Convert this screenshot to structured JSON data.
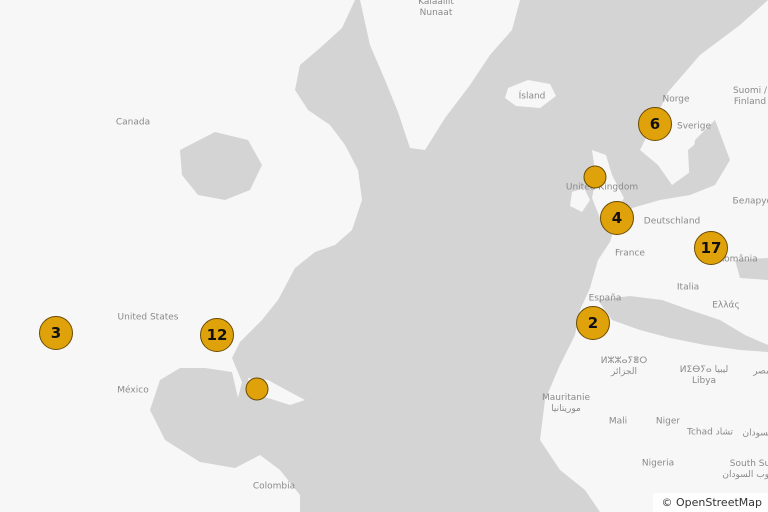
{
  "places": {
    "kalaallit": "Kalaallit",
    "nunaat": "Nunaat",
    "island": "Ísland",
    "canada": "Canada",
    "norge": "Norge",
    "suomi": "Suomi /",
    "finland": "Finland",
    "sverige": "Sverige",
    "uk": "United Kingdom",
    "deutschland": "Deutschland",
    "belarus": "Беларус",
    "france": "France",
    "romania": "România",
    "italia": "Italia",
    "espana": "España",
    "ellas": "Ελλάς",
    "united_states": "United States",
    "algeria_tif": "ⵍⵣⵣⴰⵢⴻⵔ",
    "algeria_ar": "الجزائر",
    "libya_tif": "ⵍⵉⴱⵢⴰ ليبيا",
    "libya": "Libya",
    "egypt_frag": "مصر",
    "mexico": "México",
    "mauritanie": "Mauritanie",
    "mauritania_ar": "موريتانيا",
    "mali": "Mali",
    "niger": "Niger",
    "tchad": "Tchad تشاد",
    "sudan_frag": "السودان",
    "nigeria": "Nigeria",
    "south_sudan": "South Su",
    "south_sudan_ar": "جنوب السودان",
    "colombia": "Colombia"
  },
  "clusters": {
    "california": "3",
    "southeast_us": "12",
    "caribbean": "",
    "uk": "",
    "benelux": "4",
    "scandinavia": "6",
    "balkans": "17",
    "iberia": "2"
  },
  "attribution": "© OpenStreetMap",
  "colors": {
    "land": "#f7f7f7",
    "ocean": "#d4d4d4",
    "cluster_fill": "#e0a20b",
    "cluster_stroke": "#6a4b00"
  }
}
